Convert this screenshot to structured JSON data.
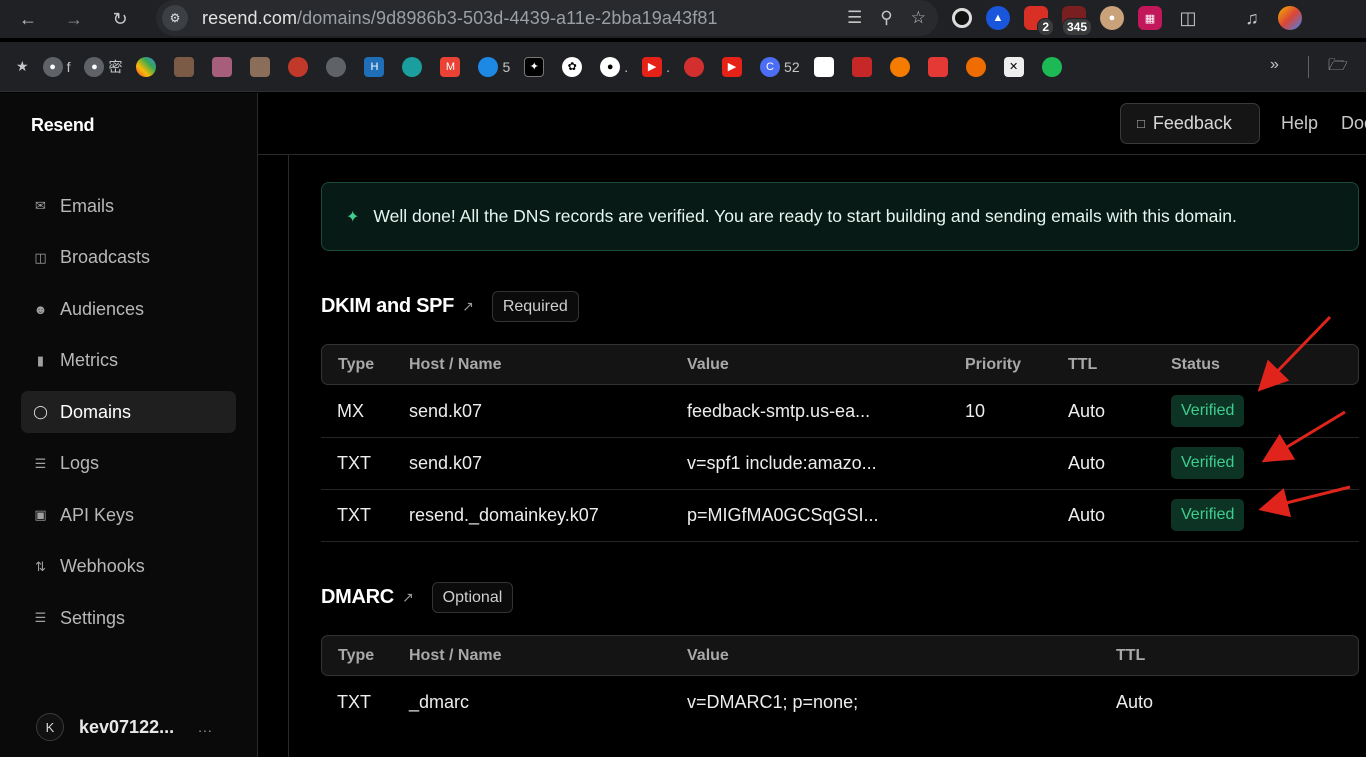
{
  "browser": {
    "url_domain": "resend.com",
    "url_path": "/domains/9d8986b3-503d-4439-a11e-2bba19a43f81",
    "extension_badges": [
      "2",
      "345"
    ],
    "bookmarks": [
      {
        "label": "f"
      },
      {
        "label": "密"
      },
      {
        "label": ""
      },
      {
        "label": ""
      },
      {
        "label": ""
      },
      {
        "label": ""
      },
      {
        "label": ""
      },
      {
        "label": ""
      },
      {
        "label": ""
      },
      {
        "label": ""
      },
      {
        "label": ""
      },
      {
        "label": "5"
      },
      {
        "label": ""
      },
      {
        "label": ""
      },
      {
        "label": "."
      },
      {
        "label": "."
      },
      {
        "label": ""
      },
      {
        "label": ""
      },
      {
        "label": "52"
      }
    ]
  },
  "sidebar": {
    "brand": "Resend",
    "items": [
      {
        "label": "Emails",
        "icon": "mail-icon"
      },
      {
        "label": "Broadcasts",
        "icon": "inbox-icon"
      },
      {
        "label": "Audiences",
        "icon": "users-icon"
      },
      {
        "label": "Metrics",
        "icon": "bar-chart-icon"
      },
      {
        "label": "Domains",
        "icon": "globe-icon",
        "active": true
      },
      {
        "label": "Logs",
        "icon": "list-icon"
      },
      {
        "label": "API Keys",
        "icon": "lock-icon"
      },
      {
        "label": "Webhooks",
        "icon": "webhook-icon"
      },
      {
        "label": "Settings",
        "icon": "sliders-icon"
      }
    ],
    "user": {
      "initial": "K",
      "name": "kev07122...",
      "more": "..."
    }
  },
  "topbar": {
    "feedback": "Feedback",
    "help": "Help",
    "docs": "Doc"
  },
  "alert": {
    "message": "Well done! All the DNS records are verified. You are ready to start building and sending emails with this domain."
  },
  "dkim": {
    "title": "DKIM and SPF",
    "badge": "Required",
    "headers": [
      "Type",
      "Host / Name",
      "Value",
      "Priority",
      "TTL",
      "Status"
    ],
    "rows": [
      {
        "type": "MX",
        "host": "send.k07",
        "value": "feedback-smtp.us-ea...",
        "priority": "10",
        "ttl": "Auto",
        "status": "Verified"
      },
      {
        "type": "TXT",
        "host": "send.k07",
        "value": "v=spf1 include:amazo...",
        "priority": "",
        "ttl": "Auto",
        "status": "Verified"
      },
      {
        "type": "TXT",
        "host": "resend._domainkey.k07",
        "value": "p=MIGfMA0GCSqGSI...",
        "priority": "",
        "ttl": "Auto",
        "status": "Verified"
      }
    ]
  },
  "dmarc": {
    "title": "DMARC",
    "badge": "Optional",
    "headers": [
      "Type",
      "Host / Name",
      "Value",
      "TTL"
    ],
    "rows": [
      {
        "type": "TXT",
        "host": "_dmarc",
        "value": "v=DMARC1; p=none;",
        "ttl": "Auto"
      }
    ]
  },
  "colors": {
    "verified_bg": "#0d3324",
    "verified_text": "#3ecf8e",
    "annotation_arrow": "#e0241b"
  }
}
